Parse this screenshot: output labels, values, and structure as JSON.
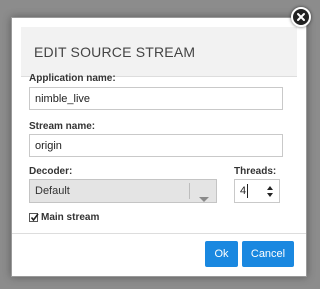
{
  "dialog": {
    "title": "EDIT SOURCE STREAM",
    "close_icon": "close-icon"
  },
  "form": {
    "application_name": {
      "label": "Application name:",
      "value": "nimble_live"
    },
    "stream_name": {
      "label": "Stream name:",
      "value": "origin"
    },
    "decoder": {
      "label": "Decoder:",
      "selected": "Default",
      "icon": "chevron-down-icon"
    },
    "threads": {
      "label": "Threads:",
      "value": "4",
      "icon": "spinner-arrows-icon"
    },
    "main_stream": {
      "label": "Main stream",
      "checked": true
    }
  },
  "buttons": {
    "ok_label": "Ok",
    "cancel_label": "Cancel"
  },
  "colors": {
    "overlay": "#8c8c8c",
    "header_bg": "#f2f2f2",
    "primary_button": "#1a88e0",
    "select_bg": "#e4e4e4"
  }
}
